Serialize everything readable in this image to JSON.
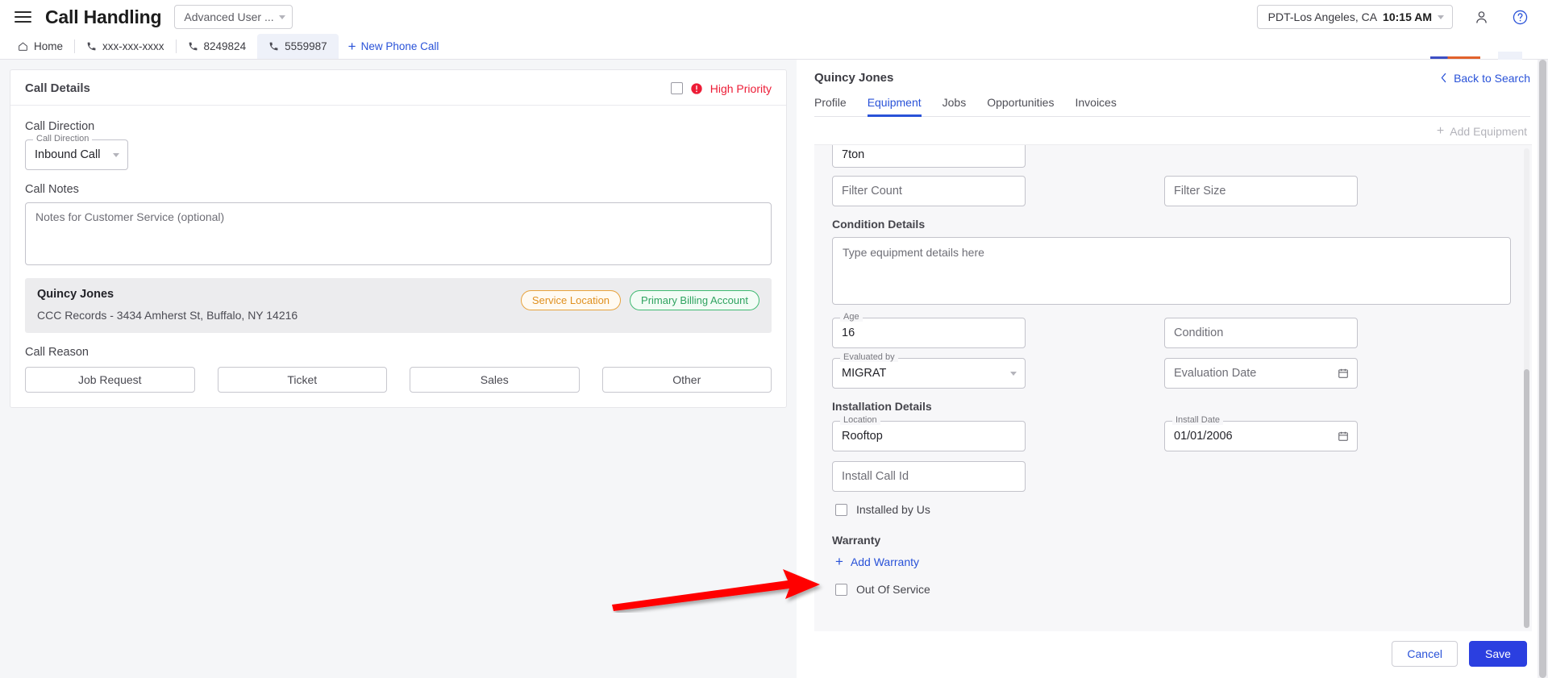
{
  "topbar": {
    "menu_icon": "hamburger-icon",
    "app_title": "Call Handling",
    "user_mode": "Advanced User ...",
    "timezone_label": "PDT-Los Angeles, CA",
    "timezone_time": "10:15 AM",
    "account_icon": "person-icon",
    "help_icon": "help-circle-icon"
  },
  "call_tabs": {
    "home_label": "Home",
    "items": [
      {
        "label": "xxx-xxx-xxxx",
        "icon": "phone-icon",
        "active": false
      },
      {
        "label": "8249824",
        "icon": "phone-icon",
        "active": false
      },
      {
        "label": "5559987",
        "icon": "phone-icon",
        "active": true
      }
    ],
    "new_call_label": "New Phone Call"
  },
  "call_details": {
    "title": "Call Details",
    "high_priority_label": "High Priority",
    "high_priority_checked": false,
    "call_direction_heading": "Call Direction",
    "call_direction_field_label": "Call Direction",
    "call_direction_value": "Inbound Call",
    "call_notes_heading": "Call Notes",
    "call_notes_placeholder": "Notes for Customer Service (optional)",
    "call_notes_value": "",
    "customer": {
      "name": "Quincy Jones",
      "address": "CCC Records - 3434 Amherst St, Buffalo, NY 14216",
      "chip_service": "Service Location",
      "chip_billing": "Primary Billing Account"
    },
    "call_reason_heading": "Call Reason",
    "reason_buttons": [
      "Job Request",
      "Ticket",
      "Sales",
      "Other"
    ]
  },
  "customer_panel": {
    "title": "Quincy Jones",
    "back_link": "Back to Search",
    "back_icon": "chevron-left-icon",
    "tabs": [
      {
        "label": "Profile",
        "active": false
      },
      {
        "label": "Equipment",
        "active": true
      },
      {
        "label": "Jobs",
        "active": false
      },
      {
        "label": "Opportunities",
        "active": false
      },
      {
        "label": "Invoices",
        "active": false
      }
    ],
    "add_equipment_label": "Add Equipment",
    "equipment_form": {
      "tonnage_value": "7ton",
      "filter_count_placeholder": "Filter Count",
      "filter_count_value": "",
      "filter_size_placeholder": "Filter Size",
      "filter_size_value": "",
      "condition_details_heading": "Condition Details",
      "condition_details_placeholder": "Type equipment details here",
      "condition_details_value": "",
      "age_label": "Age",
      "age_value": "16",
      "condition_placeholder": "Condition",
      "condition_value": "",
      "evaluated_by_label": "Evaluated by",
      "evaluated_by_value": "MIGRAT",
      "evaluation_date_placeholder": "Evaluation Date",
      "evaluation_date_value": "",
      "installation_heading": "Installation Details",
      "location_label": "Location",
      "location_value": "Rooftop",
      "install_date_label": "Install Date",
      "install_date_value": "01/01/2006",
      "install_call_id_placeholder": "Install Call Id",
      "install_call_id_value": "",
      "installed_by_us_label": "Installed by Us",
      "installed_by_us_checked": false,
      "warranty_heading": "Warranty",
      "add_warranty_label": "Add Warranty",
      "out_of_service_label": "Out Of Service",
      "out_of_service_checked": false
    },
    "cancel_label": "Cancel",
    "save_label": "Save"
  },
  "annotation": {
    "arrow_color": "#ff0000",
    "points_to": "Add Warranty"
  },
  "colors": {
    "primary_blue": "#2952d8",
    "save_blue": "#2b3fe0",
    "danger_red": "#ed1c36",
    "chip_orange": "#e0901f",
    "chip_green": "#2fa360"
  }
}
